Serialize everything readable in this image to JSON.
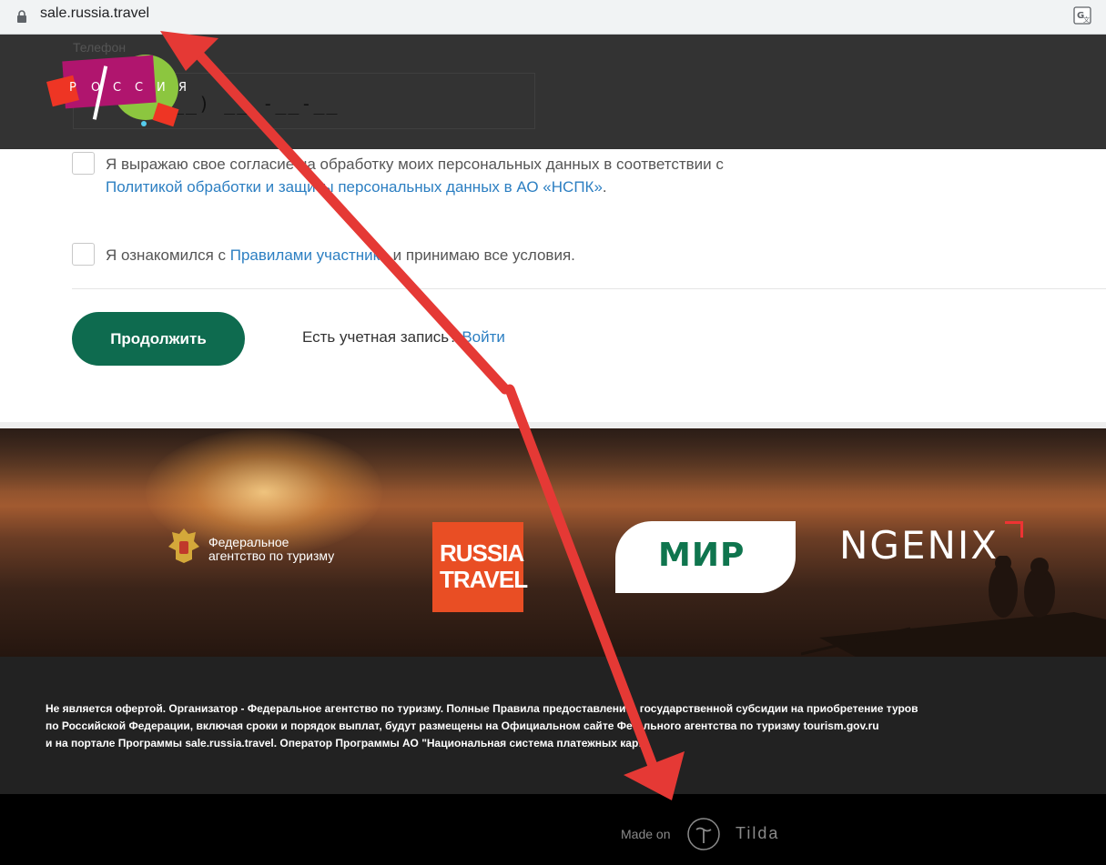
{
  "browser": {
    "url": "sale.russia.travel",
    "lock_icon": "lock-icon",
    "translate_icon": "translate-icon"
  },
  "header": {
    "phone_label": "Телефон",
    "phone_value": "__) ___-__-__",
    "logo_letters": [
      "Р",
      "О",
      "С",
      "С",
      "И",
      "Я"
    ],
    "colors": {
      "background": "#333333"
    }
  },
  "form": {
    "consent_text_before": "Я выражаю свое согласие на обработку моих персональных данных в соответствии с ",
    "consent_link": "Политикой обработки и защиты персональных данных в АО «НСПК»",
    "consent_text_after": ".",
    "rules_text_before": "Я ознакомился с ",
    "rules_link": "Правилами участника",
    "rules_text_after": " и принимаю все условия.",
    "continue_label": "Продолжить",
    "account_question": "Есть учетная запись? ",
    "login_link": "Войти",
    "colors": {
      "button": "#0e6b4f",
      "link": "#2c7fc2"
    }
  },
  "banner": {
    "fed_agency_line1": "Федеральное",
    "fed_agency_line2": "агентство по туризму",
    "russia_travel_line1": "RUSSIA",
    "russia_travel_line2": "TRAVEL",
    "mir": "МИР",
    "ngenix": "NGENIX",
    "colors": {
      "russia_travel": "#e94e24",
      "mir_text": "#0f754e"
    }
  },
  "footer": {
    "disclaimer_line1": "Не является офертой. Организатор - Федеральное агентство по туризму. Полные Правила предоставлени… государственной субсидии на приобретение туров",
    "disclaimer_line2": "по Российской Федерации, включая сроки и порядок выплат, будут размещены на Официальном сайте Фе…льного агентства по туризму tourism.gov.ru",
    "disclaimer_line3": "и на портале Программы sale.russia.travel. Оператор Программы АО \"Национальная система платежных кар…",
    "made_on": "Made on",
    "tilda": "Tilda"
  },
  "annotation": {
    "arrow_color": "#e53935"
  }
}
